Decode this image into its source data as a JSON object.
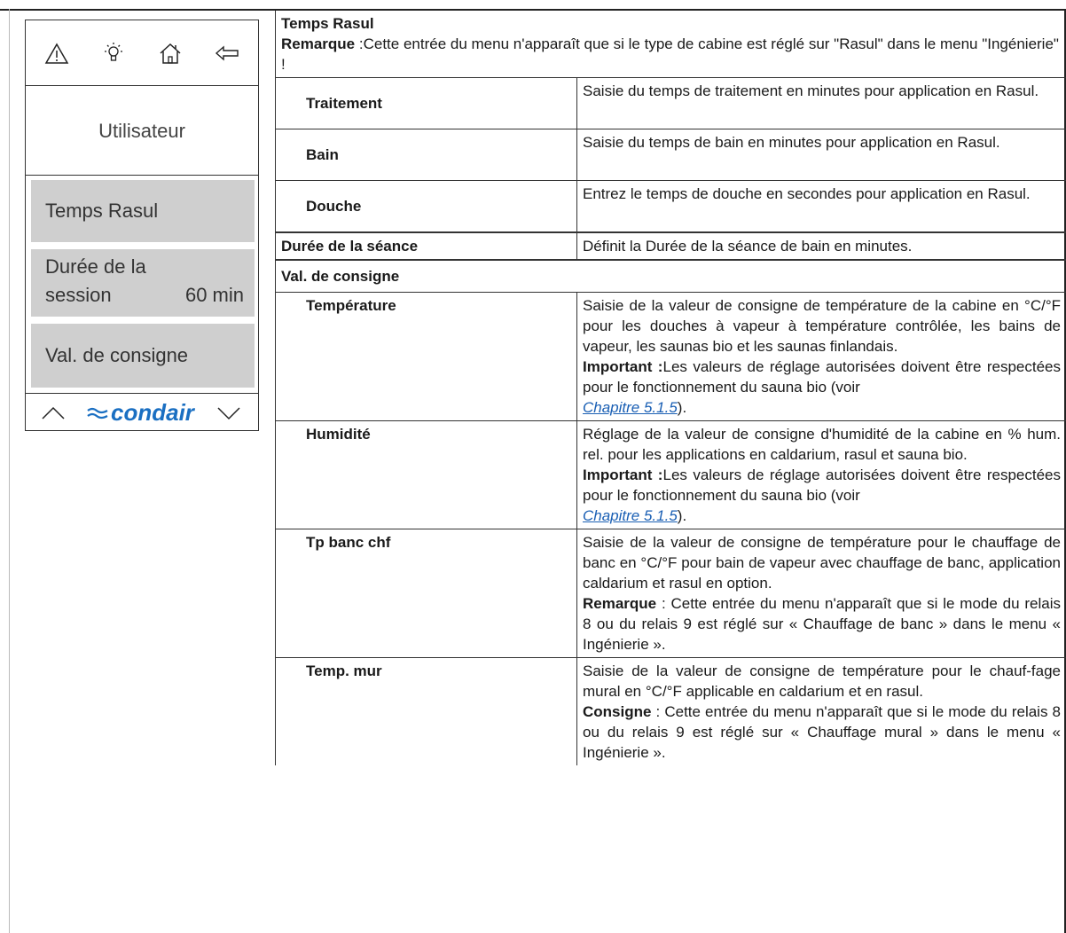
{
  "device": {
    "icons": [
      "warning-icon",
      "light-bulb-icon",
      "home-icon",
      "back-arrow-icon"
    ],
    "title": "Utilisateur",
    "items": [
      {
        "label": "Temps Rasul"
      },
      {
        "label_line1": "Durée de la",
        "label_line2": "session",
        "value": "60 min"
      },
      {
        "label": "Val. de consigne"
      }
    ],
    "brand": "condair",
    "brand_color": "#1a6fc2",
    "selected_bg": "#cfcfcf"
  },
  "table": {
    "rasul_header": {
      "title": "Temps Rasul",
      "note_label": "Remarque",
      "note_text": " :Cette entrée du menu n'apparaît que si le type de cabine est réglé sur \"Rasul\" dans le menu \"Ingénierie\" !"
    },
    "rasul_rows": [
      {
        "key": "Traitement",
        "desc": "Saisie du temps de traitement en minutes pour application en Rasul."
      },
      {
        "key": "Bain",
        "desc": "Saisie du temps de bain en minutes pour application en Rasul."
      },
      {
        "key": "Douche",
        "desc": "Entrez le temps de douche en secondes pour application en Rasul."
      }
    ],
    "seance": {
      "key": "Durée de la séance",
      "desc": "Définit la Durée de la séance de bain en minutes."
    },
    "consigne_header": "Val. de consigne",
    "temperature": {
      "key": "Température",
      "desc": "Saisie de la valeur de consigne de température de la cabine en °C/°F pour les douches à vapeur à température contrôlée, les bains de vapeur, les saunas bio et les saunas finlandais.",
      "imp_label": "Important :",
      "imp_text": "Les valeurs de réglage autorisées doivent être respectées pour le fonctionnement du sauna bio (voir ",
      "link": "Chapitre 5.1.5",
      "tail": ")."
    },
    "humidite": {
      "key": "Humidité",
      "desc": "Réglage de la valeur de consigne d'humidité de la cabine en % hum. rel. pour les applications en caldarium, rasul et sauna bio.",
      "imp_label": "Important :",
      "imp_text": "Les valeurs de réglage autorisées doivent être respectées pour le fonctionnement du sauna bio (voir ",
      "link": "Chapitre 5.1.5",
      "tail": ")."
    },
    "banc": {
      "key": "Tp banc chf",
      "desc": "Saisie de la valeur de consigne de température pour le chauffage de banc en °C/°F pour bain de vapeur avec chauffage de banc, application caldarium et rasul en option.",
      "note_label": "Remarque",
      "note_text": " : Cette entrée du menu n'apparaît que si le mode du relais 8 ou du relais 9 est réglé sur « Chauffage de banc » dans le menu « Ingénierie »."
    },
    "mur": {
      "key": "Temp. mur",
      "desc": "Saisie de la valeur de consigne de température pour le chauf-fage mural en °C/°F applicable en caldarium et en rasul.",
      "note_label": "Consigne",
      "note_text": " : Cette entrée du menu n'apparaît que si le mode du relais 8 ou du relais 9 est réglé sur « Chauffage mural » dans le menu « Ingénierie »."
    }
  }
}
